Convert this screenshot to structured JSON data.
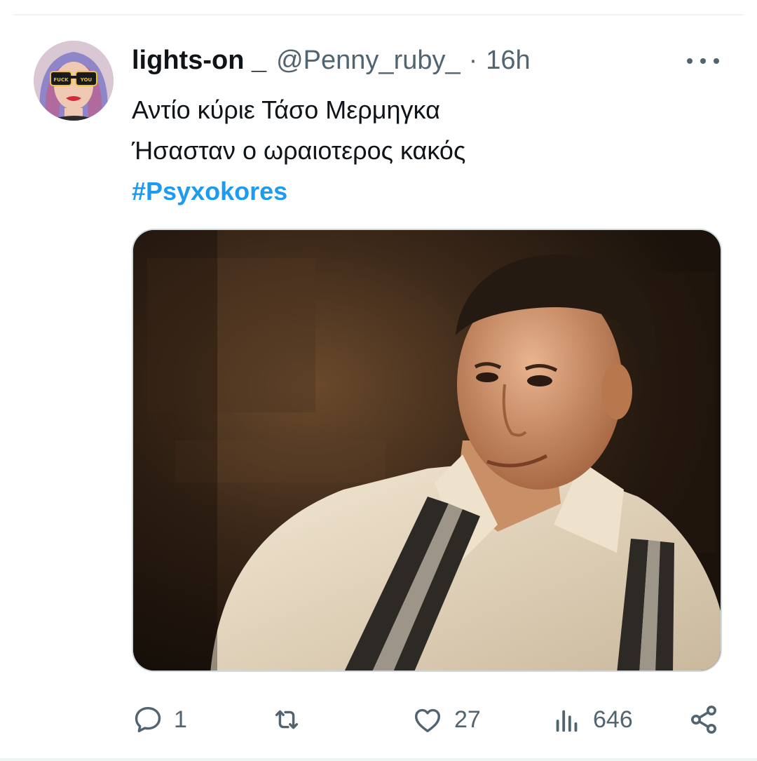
{
  "tweet": {
    "display_name": "lights-on _",
    "handle": "@Penny_ruby_",
    "separator": "·",
    "time": "16h",
    "text_lines": [
      "Αντίο κύριε Τάσο Μερμηγκα",
      "Ήσασταν ο ωραιοτερος κακός"
    ],
    "hashtag": "#Psyxokores",
    "avatar_text": "FUCK YOU",
    "media": {
      "description_icon": "photo-man-with-suspenders"
    }
  },
  "actions": {
    "reply_count": "1",
    "retweet_count": "",
    "like_count": "27",
    "views_count": "646"
  },
  "colors": {
    "text": "#0f1419",
    "secondary": "#536471",
    "link": "#1d9bf0",
    "border": "#cfd9de"
  },
  "icons": [
    "avatar",
    "more-icon",
    "reply-icon",
    "retweet-icon",
    "like-icon",
    "views-icon",
    "share-icon"
  ]
}
